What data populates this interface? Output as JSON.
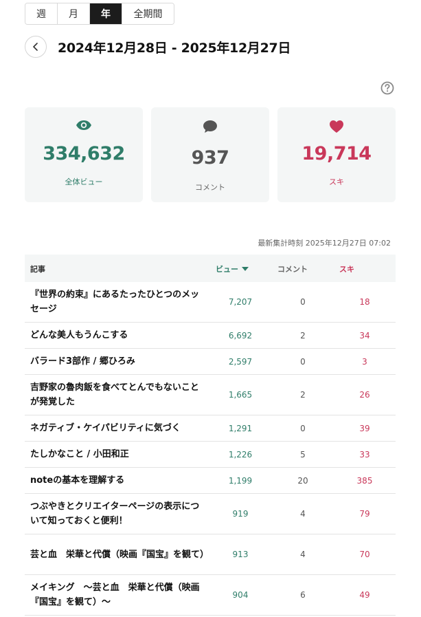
{
  "tabs": [
    {
      "label": "週",
      "active": false
    },
    {
      "label": "月",
      "active": false
    },
    {
      "label": "年",
      "active": true
    },
    {
      "label": "全期間",
      "active": false
    }
  ],
  "date_range": "2024年12月28日 - 2025年12月27日",
  "summary": {
    "views": {
      "value": "334,632",
      "label": "全体ビュー",
      "icon": "eye-icon",
      "color": "#2f7d69"
    },
    "comments": {
      "value": "937",
      "label": "コメント",
      "icon": "speech-bubble-icon",
      "color": "#555555"
    },
    "likes": {
      "value": "19,714",
      "label": "スキ",
      "icon": "heart-icon",
      "color": "#c9385a"
    }
  },
  "updated_at": "最新集計時刻 2025年12月27日 07:02",
  "table": {
    "headers": {
      "article": "記事",
      "views": "ビュー",
      "comments": "コメント",
      "likes": "スキ"
    },
    "rows": [
      {
        "title": "『世界の約束』にあるたったひとつのメッセージ",
        "views": "7,207",
        "comments": "0",
        "likes": "18"
      },
      {
        "title": "どんな美人もうんこする",
        "views": "6,692",
        "comments": "2",
        "likes": "34"
      },
      {
        "title": "バラード3部作 / 郷ひろみ",
        "views": "2,597",
        "comments": "0",
        "likes": "3"
      },
      {
        "title": "吉野家の魯肉飯を食べてとんでもないことが発覚した",
        "views": "1,665",
        "comments": "2",
        "likes": "26"
      },
      {
        "title": "ネガティブ・ケイパビリティに気づく",
        "views": "1,291",
        "comments": "0",
        "likes": "39"
      },
      {
        "title": "たしかなこと / 小田和正",
        "views": "1,226",
        "comments": "5",
        "likes": "33"
      },
      {
        "title": "noteの基本を理解する",
        "views": "1,199",
        "comments": "20",
        "likes": "385"
      },
      {
        "title": "つぶやきとクリエイターページの表示について知っておくと便利！",
        "views": "919",
        "comments": "4",
        "likes": "79"
      },
      {
        "title": "芸と血　栄華と代償（映画『国宝』を観て）",
        "views": "913",
        "comments": "4",
        "likes": "70"
      },
      {
        "title": "メイキング　〜芸と血　栄華と代償（映画『国宝』を観て）〜",
        "views": "904",
        "comments": "6",
        "likes": "49"
      }
    ]
  }
}
